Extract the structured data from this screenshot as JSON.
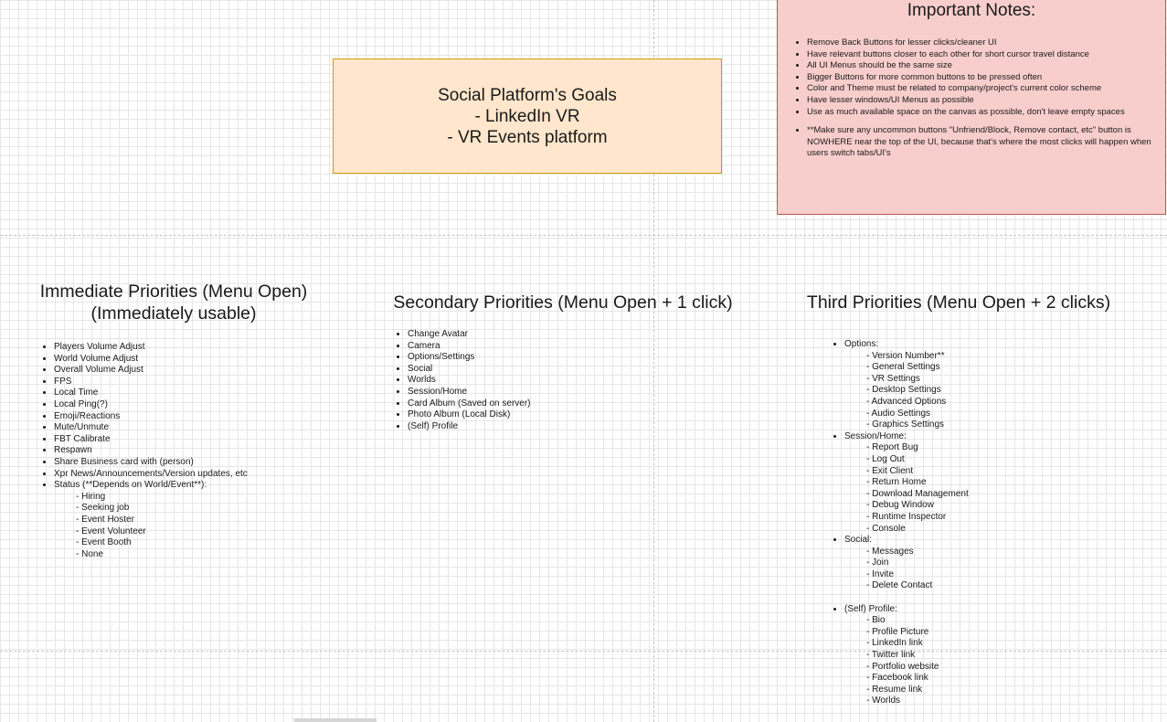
{
  "goals": {
    "lines": [
      "Social Platform's Goals",
      "- LinkedIn VR",
      "- VR Events platform"
    ]
  },
  "notes": {
    "title": "Important Notes:",
    "items": [
      "Remove Back Buttons for lesser clicks/cleaner UI",
      "Have relevant buttons closer to each other for short cursor travel distance",
      "All UI Menus should be the same size",
      "Bigger Buttons for more common buttons to be pressed often",
      "Color and Theme must be related to company/project's current color scheme",
      "Have lesser windows/UI Menus as possible",
      "Use as much available space on the canvas as possible, don't leave empty spaces",
      "**Make sure any uncommon buttons \"Unfriend/Block, Remove contact, etc\" button is NOWHERE near the top of the UI, because that's where the most clicks will happen when users switch tabs/UI's"
    ]
  },
  "immediate": {
    "title_line1": "Immediate Priorities (Menu Open)",
    "title_line2": "(Immediately usable)",
    "items": [
      "Players Volume Adjust",
      "World Volume Adjust",
      "Overall Volume Adjust",
      "FPS",
      "Local Time",
      "Local Ping(?)",
      "Emoji/Reactions",
      "Mute/Unmute",
      "FBT Calibrate",
      "Respawn",
      "Share Business card with (person)",
      "Xpr News/Announcements/Version updates, etc",
      "Status (**Depends on World/Event**):"
    ],
    "status_sub": [
      "- Hiring",
      "- Seeking job",
      "- Event Hoster",
      "- Event Volunteer",
      "- Event Booth",
      "- None"
    ]
  },
  "secondary": {
    "title": "Secondary Priorities (Menu Open + 1 click)",
    "items": [
      "Change Avatar",
      "Camera",
      "Options/Settings",
      "Social",
      "Worlds",
      "Session/Home",
      "Card Album (Saved on server)",
      "Photo Album (Local Disk)",
      "(Self) Profile"
    ]
  },
  "third": {
    "title": "Third Priorities (Menu Open + 2 clicks)",
    "options": {
      "label": "Options:",
      "sub": [
        "- Version Number**",
        "- General Settings",
        "- VR Settings",
        "- Desktop Settings",
        "- Advanced Options",
        "- Audio Settings",
        "- Graphics Settings"
      ]
    },
    "session": {
      "label": "Session/Home:",
      "sub": [
        "- Report Bug",
        "- Log Out",
        "- Exit Client",
        "- Return Home",
        "- Download Management",
        "- Debug Window",
        "- Runtime Inspector",
        "- Console"
      ]
    },
    "social": {
      "label": "Social:",
      "sub": [
        "- Messages",
        "- Join",
        "- Invite",
        "- Delete Contact"
      ]
    },
    "profile": {
      "label": "(Self) Profile:",
      "sub": [
        "- Bio",
        "- Profile Picture",
        "- LinkedIn link",
        "- Twitter link",
        "- Portfolio website",
        "- Facebook link",
        "- Resume link",
        "- Worlds"
      ]
    }
  }
}
